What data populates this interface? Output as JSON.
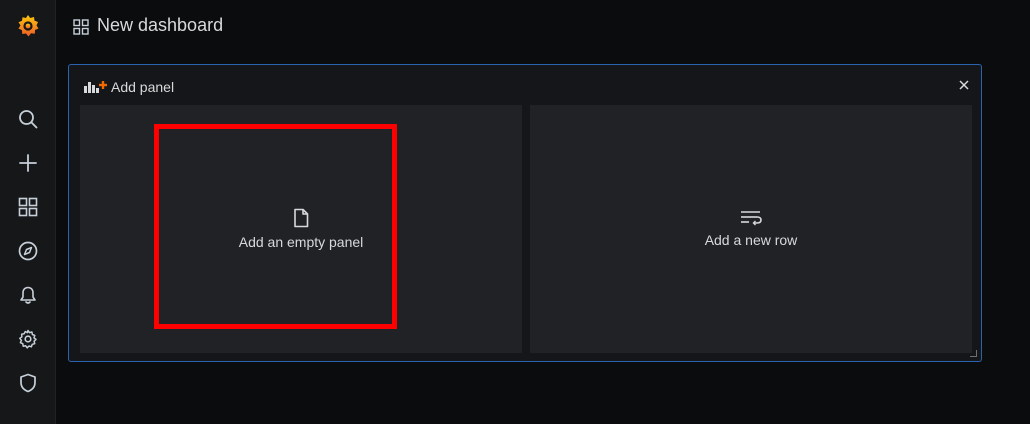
{
  "app": {
    "name": "Grafana",
    "accent_color": "#f46800"
  },
  "sidebar": {
    "items": [
      {
        "icon": "search-icon"
      },
      {
        "icon": "plus-icon"
      },
      {
        "icon": "dashboards-icon"
      },
      {
        "icon": "explore-compass-icon"
      },
      {
        "icon": "bell-icon"
      },
      {
        "icon": "gear-icon"
      },
      {
        "icon": "shield-icon"
      }
    ]
  },
  "header": {
    "title": "New dashboard",
    "icon": "dashboards-icon"
  },
  "panel": {
    "title": "Add panel",
    "icon": "add-panel-icon",
    "close_icon": "close-icon",
    "border_color": "#2a63b0",
    "options": [
      {
        "label": "Add an empty panel",
        "icon": "file-icon"
      },
      {
        "label": "Add a new row",
        "icon": "row-icon"
      }
    ]
  },
  "annotation": {
    "highlight_color": "#ff0000"
  }
}
